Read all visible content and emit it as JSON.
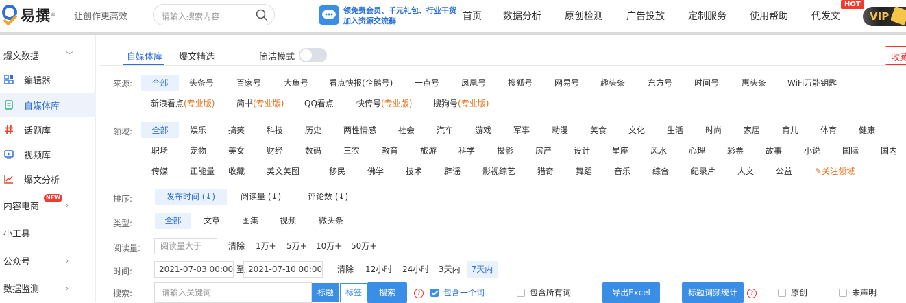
{
  "header": {
    "logo_text": "易撰",
    "slogan": "让创作更高效",
    "search_placeholder": "请输入搜索内容",
    "promo_line1": "领免费会员、千元礼包、行业干货",
    "promo_line2": "加入资源交流群",
    "nav": [
      "首页",
      "数据分析",
      "原创检测",
      "广告投放",
      "定制服务",
      "使用帮助",
      "代发文"
    ],
    "hot_badge": "HOT",
    "vip_label": "VIP"
  },
  "sidebar": {
    "items": [
      {
        "label": "爆文数据",
        "chevron": "down",
        "icon": "none"
      },
      {
        "label": "编辑器",
        "icon": "grid-icon"
      },
      {
        "label": "自媒体库",
        "icon": "document-icon",
        "active": true
      },
      {
        "label": "话题库",
        "icon": "hashtag-icon"
      },
      {
        "label": "视频库",
        "icon": "video-icon"
      },
      {
        "label": "爆文分析",
        "icon": "chart-icon"
      },
      {
        "label": "内容电商",
        "badge": "NEW",
        "chevron": "right"
      },
      {
        "label": "小工具"
      },
      {
        "label": "公众号",
        "chevron": "right"
      },
      {
        "label": "数据监测",
        "chevron": "right"
      }
    ]
  },
  "tabs": {
    "items": [
      "自媒体库",
      "爆文精选"
    ],
    "simple_mode": "简洁模式",
    "collect": "收藏"
  },
  "source": {
    "label": "来源:",
    "row1": [
      "全部",
      "头条号",
      "百家号",
      "大鱼号",
      "看点快报(企鹅号)",
      "一点号",
      "凤凰号",
      "搜狐号",
      "网易号",
      "趣头条",
      "东方号",
      "时间号",
      "惠头条",
      "WiFi万能钥匙"
    ],
    "row2": [
      {
        "name": "新浪看点",
        "pro": "(专业版)"
      },
      {
        "name": "简书",
        "pro": "(专业版)"
      },
      {
        "name": "QQ看点",
        "pro": ""
      },
      {
        "name": "快传号",
        "pro": "(专业版)"
      },
      {
        "name": "搜狗号",
        "pro": "(专业版)"
      }
    ]
  },
  "field": {
    "label": "领域:",
    "row1": [
      "全部",
      "娱乐",
      "搞笑",
      "科技",
      "历史",
      "两性情感",
      "社会",
      "汽车",
      "游戏",
      "军事",
      "动漫",
      "美食",
      "文化",
      "生活",
      "时尚",
      "家居",
      "育儿",
      "体育",
      "健康"
    ],
    "row2": [
      "职场",
      "宠物",
      "美女",
      "财经",
      "数码",
      "三农",
      "教育",
      "旅游",
      "科学",
      "摄影",
      "房产",
      "设计",
      "星座",
      "风水",
      "心理",
      "彩票",
      "故事",
      "小说",
      "国际",
      "国内"
    ],
    "row3": [
      "传媒",
      "正能量",
      "收藏",
      "美文美图",
      "移民",
      "佛学",
      "技术",
      "辟谣",
      "影视综艺",
      "猎奇",
      "舞蹈",
      "音乐",
      "综合",
      "纪录片",
      "人文",
      "公益"
    ],
    "follow": "关注领域"
  },
  "sort": {
    "label": "排序:",
    "items": [
      "发布时间 (↓)",
      "阅读量 (↓)",
      "评论数 (↓)"
    ]
  },
  "type": {
    "label": "类型:",
    "items": [
      "全部",
      "文章",
      "图集",
      "视频",
      "微头条"
    ]
  },
  "reads": {
    "label": "阅读量:",
    "placeholder": "阅读量大于",
    "clear": "清除",
    "items": [
      "1万+",
      "5万+",
      "10万+",
      "50万+"
    ]
  },
  "time": {
    "label": "时间:",
    "start": "2021-07-03 00:00",
    "to": "至",
    "end": "2021-07-10 00:00",
    "clear": "清除",
    "items": [
      "12小时",
      "24小时",
      "3天内",
      "7天内"
    ]
  },
  "search": {
    "label": "搜索:",
    "placeholder": "请输入关键词",
    "toggle_title": "标题",
    "toggle_tag": "标签",
    "search_btn": "搜索",
    "contains_one": "包含一个词",
    "contains_all": "包含所有词",
    "export_btn": "导出Excel",
    "stats_btn": "标题词频统计",
    "original": "原创",
    "undeclared": "未声明"
  }
}
